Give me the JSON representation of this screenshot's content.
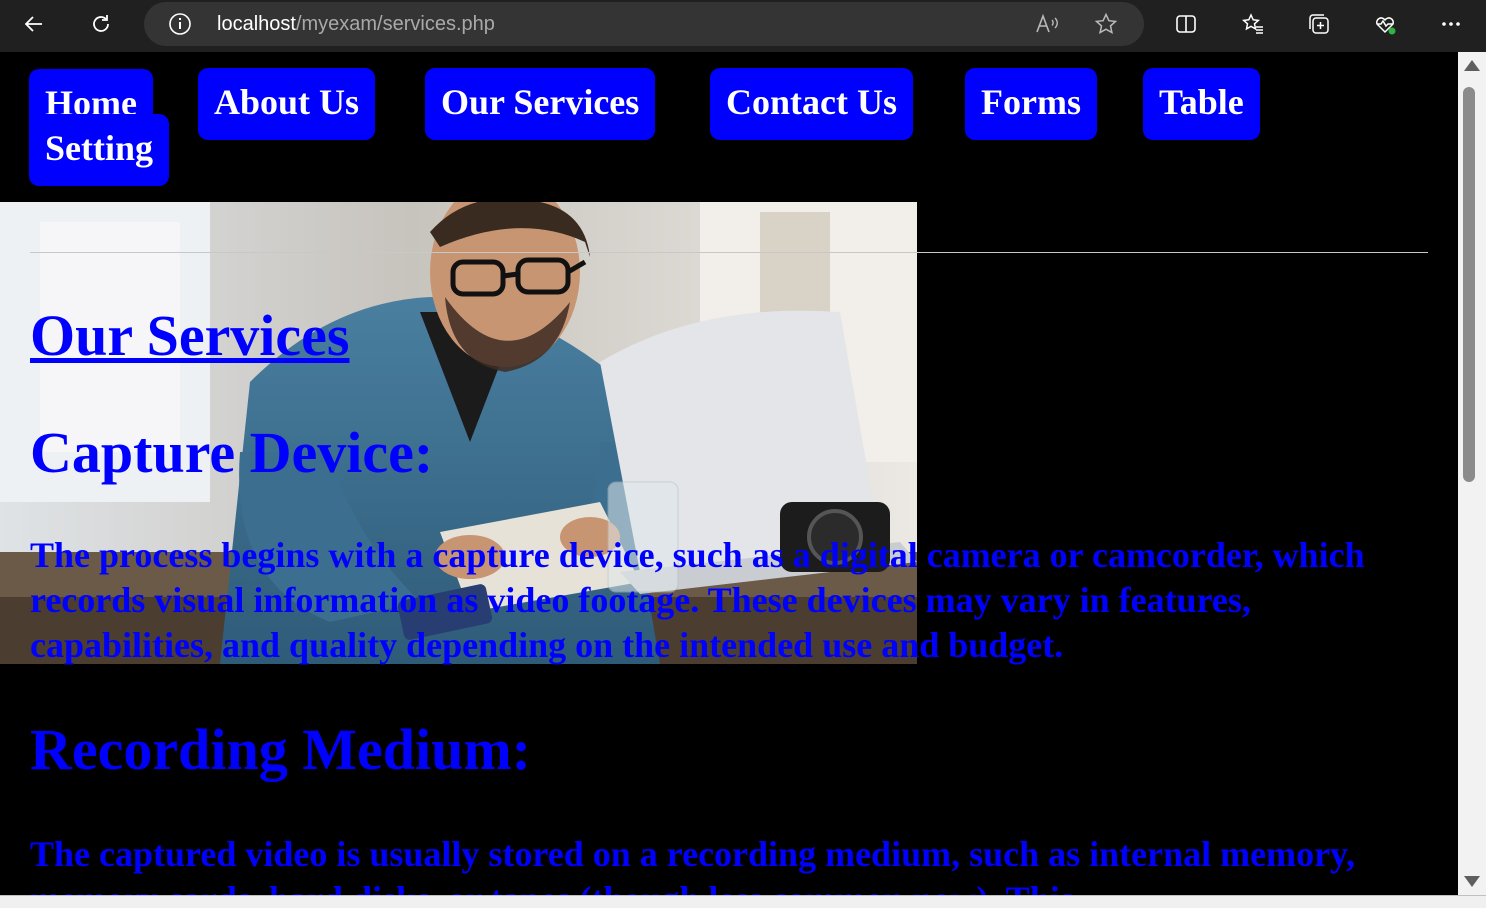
{
  "browser": {
    "url_host": "localhost",
    "url_path": "/myexam/services.php",
    "icons": {
      "back": "back-arrow-icon",
      "refresh": "refresh-icon",
      "info": "info-icon",
      "read_aloud": "read-aloud-icon",
      "favorite": "star-icon",
      "split": "split-screen-icon",
      "favorites": "favorites-icon",
      "collections": "collections-icon",
      "health": "browser-essentials-icon",
      "menu": "more-icon"
    }
  },
  "nav": {
    "home": "Home",
    "about": "About Us",
    "services": "Our Services",
    "contact": "Contact Us",
    "forms": "Forms",
    "table": "Table",
    "setting": "Setting"
  },
  "content": {
    "title": "Our Services",
    "sections": [
      {
        "heading": "Capture Device:",
        "text": "The process begins with a capture device, such as a digital camera or camcorder, which records visual information as video footage. These devices may vary in features, capabilities, and quality depending on the intended use and budget."
      },
      {
        "heading": "Recording Medium:",
        "text": "The captured video is usually stored on a recording medium, such as internal memory, memory cards, hard disks, or tapes (though less common now). This"
      }
    ]
  },
  "colors": {
    "page_bg": "#000000",
    "accent": "#0000ff",
    "nav_text": "#ffffff"
  }
}
